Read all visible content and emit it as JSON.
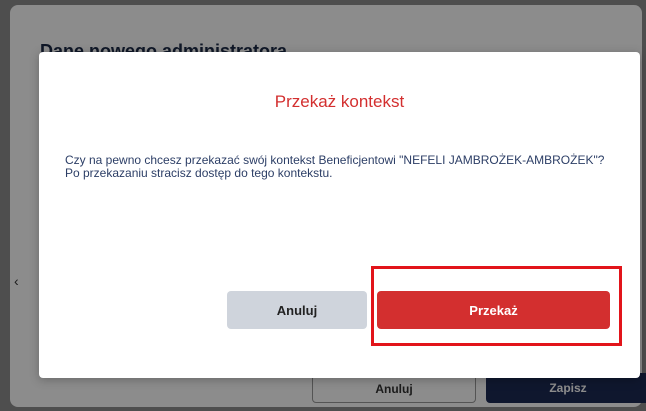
{
  "background": {
    "section_title": "Dane nowego administratora",
    "left_chevron": "‹",
    "outline_button_label": "Anuluj",
    "solid_button_label": "Zapisz"
  },
  "dialog": {
    "title": "Przekaż kontekst",
    "body_line_1": "Czy na pewno chcesz przekazać swój kontekst Beneficjentowi \"NEFELI JAMBROŻEK-AMBROŻEK\"?",
    "body_line_2": "Po przekazaniu stracisz dostęp do tego kontekstu.",
    "cancel_label": "Anuluj",
    "confirm_label": "Przekaż"
  },
  "colors": {
    "accent_red": "#d32f2f",
    "highlight_red": "#e2141a",
    "cancel_gray": "#cfd4dc",
    "navy": "#1c2a55"
  }
}
